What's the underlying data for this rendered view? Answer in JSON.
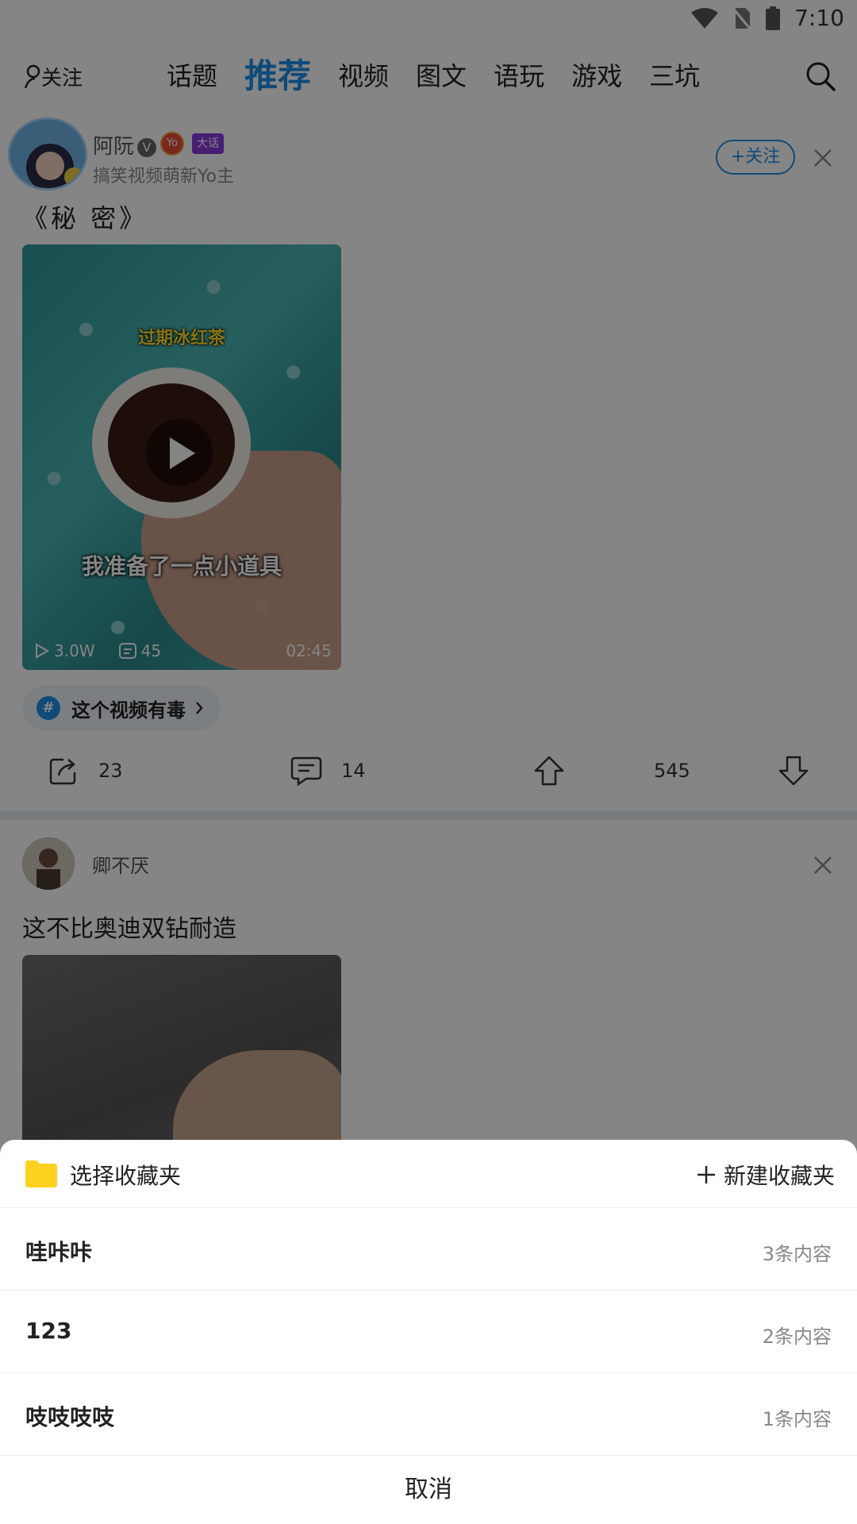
{
  "status_bar": {
    "time": "7:10"
  },
  "nav": {
    "follow_label": "关注",
    "tabs": [
      "话题",
      "推荐",
      "视频",
      "图文",
      "语玩",
      "游戏",
      "三坑"
    ],
    "active_tab": "推荐"
  },
  "post1": {
    "author": "阿阮",
    "badge_yo": "Yo",
    "badge_level": "大话",
    "author_sub": "搞笑视频萌新Yo主",
    "follow_btn": "+关注",
    "title": "《秘 密》",
    "video": {
      "caption_top": "过期冰红茶",
      "caption_bottom": "我准备了一点小道具",
      "play_count": "3.0W",
      "comment_count": "45",
      "duration": "02:45"
    },
    "topic": "这个视频有毒",
    "actions": {
      "share": "23",
      "comment": "14",
      "up": "545"
    }
  },
  "post2": {
    "author": "卿不厌",
    "title": "这不比奥迪双钻耐造"
  },
  "sheet": {
    "title": "选择收藏夹",
    "new_folder": "新建收藏夹",
    "folders": [
      {
        "name": "哇咔咔",
        "count": "3条内容"
      },
      {
        "name": "123",
        "count": "2条内容"
      },
      {
        "name": "吱吱吱吱",
        "count": "1条内容"
      }
    ],
    "cancel": "取消"
  },
  "colors": {
    "accent": "#1e8fe8",
    "folder": "#ffd21f",
    "overlay": "rgba(0,0,0,0.48)"
  }
}
